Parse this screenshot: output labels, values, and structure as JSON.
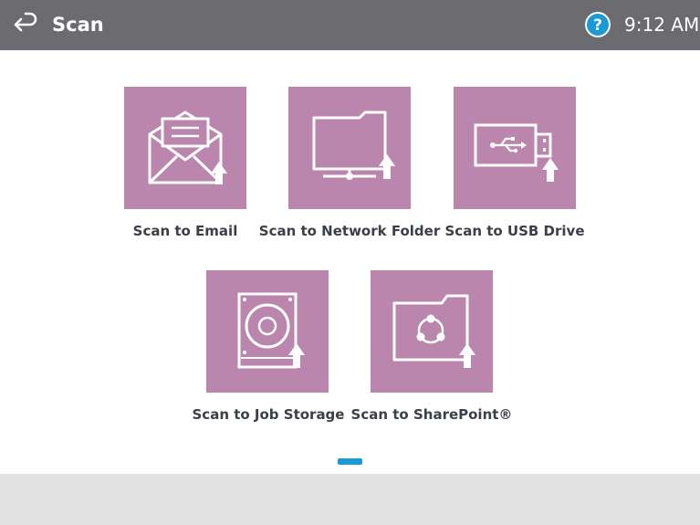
{
  "header": {
    "title": "Scan",
    "time": "9:12 AM",
    "back_icon": "back-arrow-icon",
    "help_icon": "help-icon",
    "help_glyph": "?"
  },
  "colors": {
    "header_bg": "#6b6b70",
    "tile_bg": "#bb86ad",
    "help_blue": "#1c9ad6",
    "page_indicator": "#1c9ad6",
    "footer_bg": "#e2e2e2"
  },
  "tiles": [
    {
      "label": "Scan to Email",
      "icon": "envelope-upload-icon"
    },
    {
      "label": "Scan to Network Folder",
      "icon": "network-folder-upload-icon"
    },
    {
      "label": "Scan to USB Drive",
      "icon": "usb-drive-upload-icon"
    },
    {
      "label": "Scan to Job Storage",
      "icon": "hard-drive-upload-icon"
    },
    {
      "label": "Scan to SharePoint®",
      "icon": "sharepoint-folder-upload-icon"
    }
  ],
  "pagination": {
    "current_page": 1,
    "total_pages": 1
  }
}
